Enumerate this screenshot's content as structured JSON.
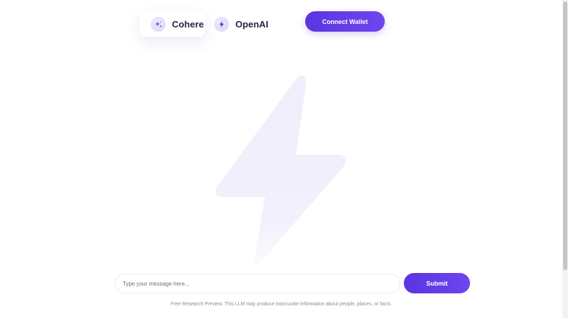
{
  "models": [
    {
      "label": "Cohere",
      "icon": "sparkles-icon",
      "active": true
    },
    {
      "label": "OpenAI",
      "icon": "lightning-bolt-icon",
      "active": false
    }
  ],
  "header": {
    "connect_wallet_label": "Connect Wallet"
  },
  "chat": {
    "placeholder": "Type your message here...",
    "value": "",
    "submit_label": "Submit",
    "disclaimer": "Free Research Preview. This LLM may produce inaccurate information about people, places, or facts."
  },
  "colors": {
    "accent": "#5b36e2",
    "accent_light": "#6f46ee",
    "icon_bg": "#e4e2f8",
    "hero_bolt": "#eeedfb"
  }
}
